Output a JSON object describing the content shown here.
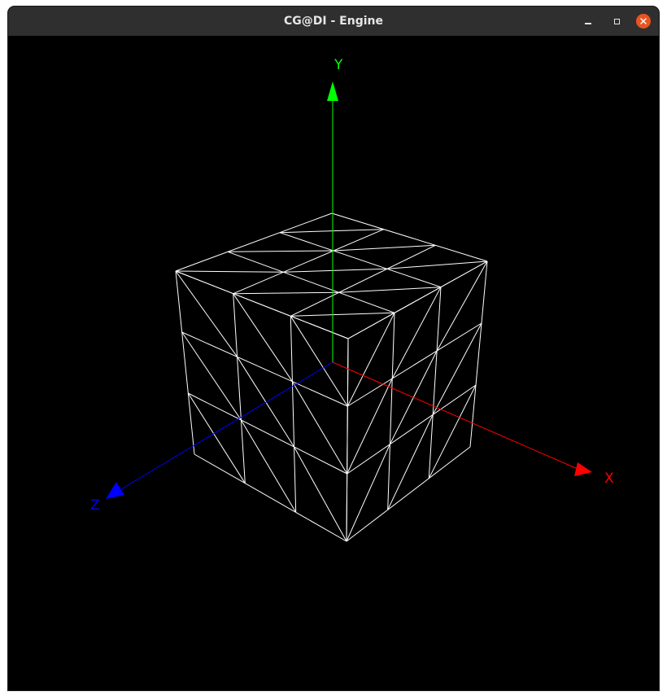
{
  "window": {
    "title": "CG@DI - Engine",
    "controls": {
      "minimize": "minimize-icon",
      "maximize": "maximize-icon",
      "close": "close-icon"
    }
  },
  "scene": {
    "background": "#000000",
    "wireframe_color": "#ffffff",
    "model": "cube",
    "subdivisions": 3,
    "axes": {
      "x": {
        "label": "X",
        "color": "#ff0000"
      },
      "y": {
        "label": "Y",
        "color": "#00ff00"
      },
      "z": {
        "label": "Z",
        "color": "#0000ff"
      }
    }
  }
}
